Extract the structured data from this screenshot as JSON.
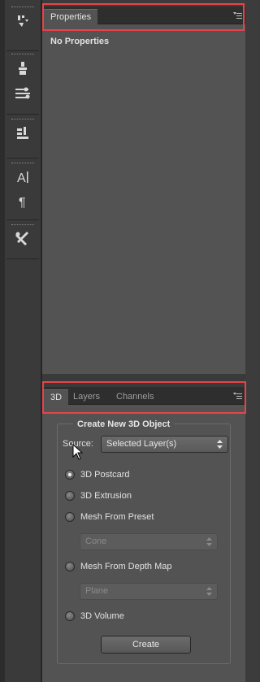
{
  "properties_panel": {
    "tab_label": "Properties",
    "message": "No Properties",
    "menu_icon": "panel-menu-icon"
  },
  "threed_panel": {
    "tabs": [
      {
        "label": "3D"
      },
      {
        "label": "Layers"
      },
      {
        "label": "Channels"
      }
    ],
    "group_title": "Create New 3D Object",
    "source_label": "Source:",
    "source_value": "Selected Layer(s)",
    "options": [
      {
        "label": "3D Postcard",
        "checked": true
      },
      {
        "label": "3D Extrusion",
        "checked": false
      },
      {
        "label": "Mesh From Preset",
        "checked": false
      },
      {
        "label": "Mesh From Depth Map",
        "checked": false
      },
      {
        "label": "3D Volume",
        "checked": false
      }
    ],
    "preset_value": "Cone",
    "depth_map_value": "Plane",
    "create_label": "Create"
  },
  "toolbar_icons": [
    "brush-settings-icon",
    "clone-source-icon",
    "adjustments-icon",
    "layer-comps-icon",
    "character-icon",
    "paragraph-icon",
    "tools-icon"
  ],
  "colors": {
    "panel_bg": "#535353",
    "dock_bg": "#3a3a3a",
    "tab_bar": "#2e2e2e",
    "highlight": "#e8434b"
  }
}
